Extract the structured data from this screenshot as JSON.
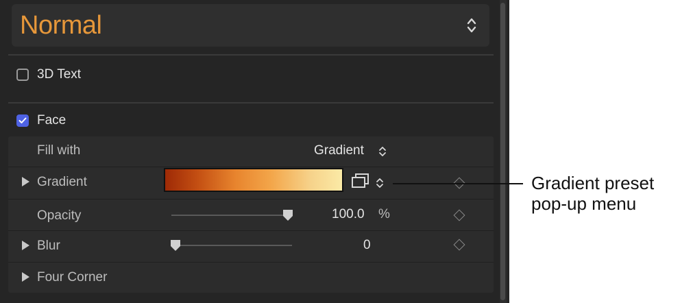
{
  "preset": {
    "value": "Normal"
  },
  "text3d": {
    "label": "3D Text",
    "checked": false
  },
  "face": {
    "label": "Face",
    "checked": true
  },
  "fill_with": {
    "label": "Fill with",
    "value": "Gradient"
  },
  "gradient": {
    "label": "Gradient",
    "colors": [
      "#9e2a06",
      "#e8852e",
      "#fbeaa6"
    ]
  },
  "opacity": {
    "label": "Opacity",
    "value": "100.0",
    "unit": "%",
    "level": 1.0
  },
  "blur": {
    "label": "Blur",
    "value": "0",
    "level": 0.0
  },
  "four_corner": {
    "label": "Four Corner"
  },
  "callout": {
    "line1": "Gradient preset",
    "line2": "pop-up menu"
  },
  "colors": {
    "accent_orange": "#e6973a",
    "check_blue": "#4e62e4",
    "panel_bg": "#252525"
  }
}
